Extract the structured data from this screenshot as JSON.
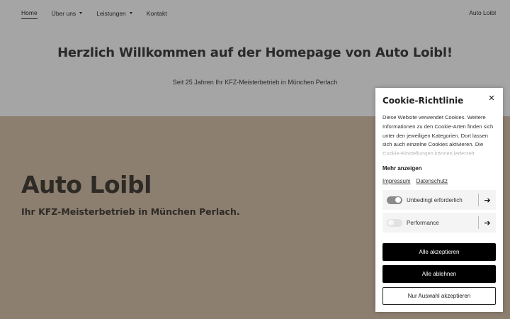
{
  "nav": {
    "items": [
      {
        "label": "Home",
        "active": true,
        "dropdown": false
      },
      {
        "label": "Über uns",
        "active": false,
        "dropdown": true
      },
      {
        "label": "Leistungen",
        "active": false,
        "dropdown": true
      },
      {
        "label": "Kontakt",
        "active": false,
        "dropdown": false
      }
    ],
    "brand": "Auto Loibl"
  },
  "hero": {
    "title": "Herzlich Willkommen auf der Homepage von Auto Loibl!",
    "subtitle": "Seit 25 Jahren Ihr KFZ-Meisterbetrieb in München Perlach"
  },
  "section": {
    "title": "Auto Loibl",
    "subtitle": "Ihr KFZ-Meisterbetrieb in München Perlach."
  },
  "cookie": {
    "title": "Cookie-Richtlinie",
    "close_icon": "close-icon",
    "text": "Diese Website verwendet Cookies. Weitere Informationen zu den Cookie-Arten finden sich unter den jeweiligen Kategorien. Dort lassen sich auch einzelne Cookies aktivieren. Die Cookie-Einstellungen können jederzeit",
    "more_label": "Mehr anzeigen",
    "links": [
      "Impressum",
      "Datenschutz"
    ],
    "options": [
      {
        "label": "Unbedingt erforderlich",
        "enabled": true
      },
      {
        "label": "Performance",
        "enabled": false
      }
    ],
    "buttons": {
      "accept_all": "Alle akzeptieren",
      "reject_all": "Alle ablehnen",
      "accept_selection": "Nur Auswahl akzeptieren"
    }
  },
  "colors": {
    "top_bg": "#a5a5a5",
    "brown_bg": "#8c7f70",
    "button_dark": "#000000"
  }
}
